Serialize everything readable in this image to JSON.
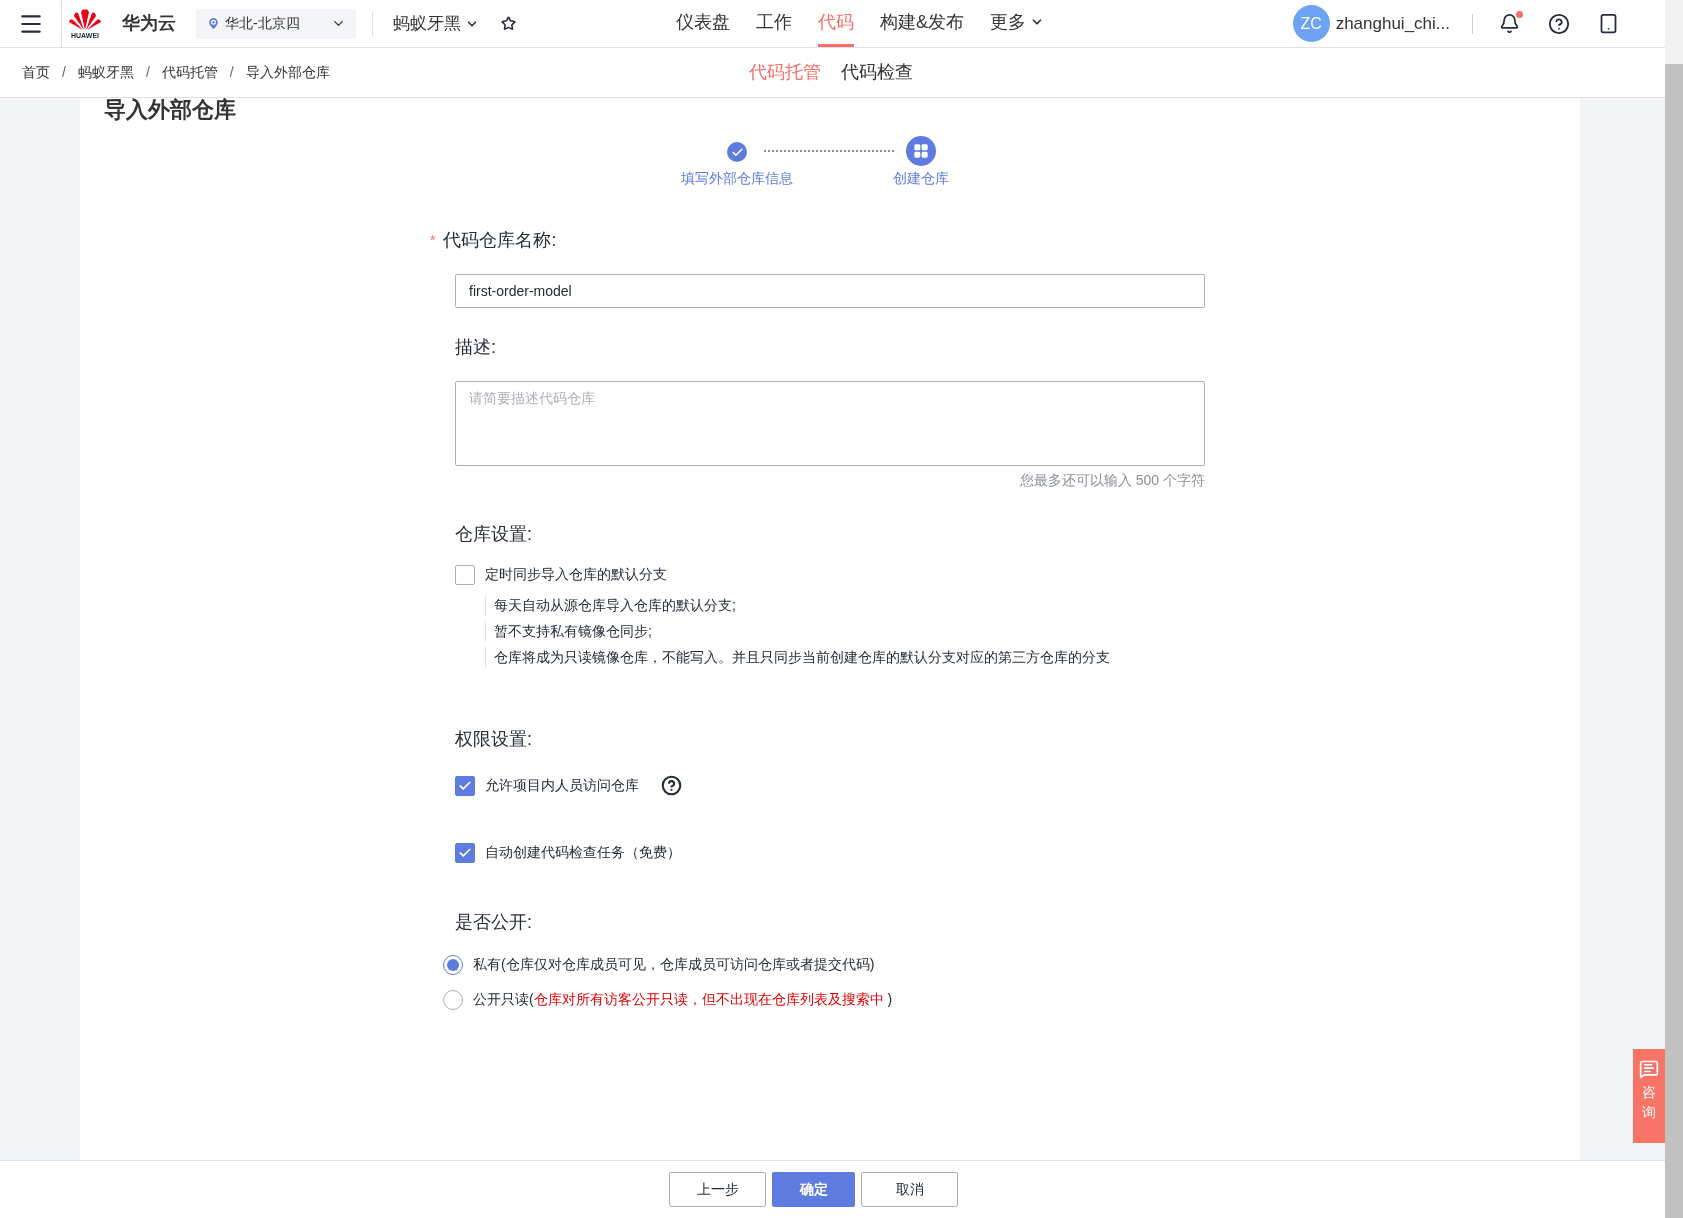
{
  "header": {
    "brand": "华为云",
    "logo_text": "HUAWEI",
    "region": "华北-北京四",
    "project": "蚂蚁牙黑",
    "nav": [
      {
        "label": "仪表盘",
        "selected": false,
        "dropdown": false
      },
      {
        "label": "工作",
        "selected": false,
        "dropdown": false
      },
      {
        "label": "代码",
        "selected": true,
        "dropdown": false
      },
      {
        "label": "构建&发布",
        "selected": false,
        "dropdown": false
      },
      {
        "label": "更多",
        "selected": false,
        "dropdown": true
      }
    ],
    "user": {
      "initials": "ZC",
      "name": "zhanghui_chi..."
    },
    "notification_dot": true
  },
  "breadcrumb": {
    "separator": "/",
    "items": [
      "首页",
      "蚂蚁牙黑",
      "代码托管",
      "导入外部仓库"
    ]
  },
  "subtabs": [
    {
      "label": "代码托管",
      "selected": true
    },
    {
      "label": "代码检查",
      "selected": false
    }
  ],
  "page_title": "导入外部仓库",
  "steps": [
    {
      "label": "填写外部仓库信息",
      "kind": "done"
    },
    {
      "label": "创建仓库",
      "kind": "current"
    }
  ],
  "name_field": {
    "label": "代码仓库名称:",
    "required_mark": "*",
    "value": "first-order-model"
  },
  "description_field": {
    "label": "描述:",
    "placeholder": "请简要描述代码仓库",
    "hint": "您最多还可以输入 500 个字符"
  },
  "repo_settings": {
    "label": "仓库设置:",
    "option": {
      "label": "定时同步导入仓库的默认分支",
      "checked": false
    },
    "notes": [
      "每天自动从源仓库导入仓库的默认分支;",
      "暂不支持私有镜像仓同步;",
      "仓库将成为只读镜像仓库，不能写入。并且只同步当前创建仓库的默认分支对应的第三方仓库的分支"
    ]
  },
  "permissions": {
    "label": "权限设置:",
    "options": [
      {
        "label": "允许项目内人员访问仓库",
        "checked": true,
        "help": true
      },
      {
        "label": "自动创建代码检查任务（免费）",
        "checked": true,
        "help": false
      }
    ]
  },
  "visibility": {
    "label": "是否公开:",
    "options": [
      {
        "label": "私有(仓库仅对仓库成员可见，仓库成员可访问仓库或者提交代码)",
        "selected": true
      },
      {
        "label": "公开只读(",
        "note": "仓库对所有访客公开只读，但不出现在仓库列表及搜索中",
        "suffix": " )",
        "selected": false
      }
    ]
  },
  "buttons": [
    {
      "label": "上一步",
      "kind": "secondary"
    },
    {
      "label": "确定",
      "kind": "primary"
    },
    {
      "label": "取消",
      "kind": "secondary"
    }
  ],
  "consult": "咨询"
}
